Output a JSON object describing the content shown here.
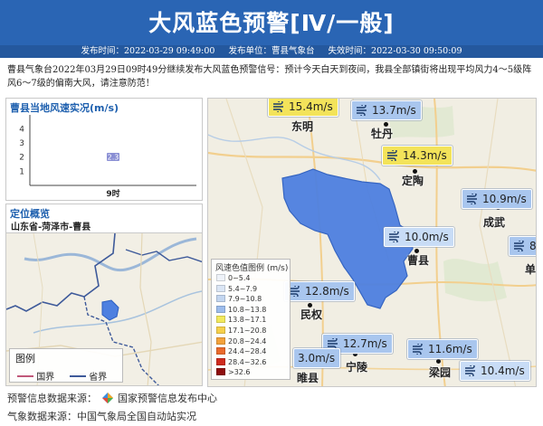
{
  "header": {
    "title": "大风蓝色预警[Ⅳ/一般]",
    "publish_time_label": "发布时间：2022-03-29 09:49:00",
    "publisher_label": "发布单位：曹县气象台",
    "expire_label": "失效时间：2022-03-30 09:50:09"
  },
  "description": "曹县气象台2022年03月29日09时49分继续发布大风蓝色预警信号：预计今天白天到夜间，我县全部镇街将出现平均风力4～5级阵风6～7级的偏南大风，请注意防范！",
  "wind_panel": {
    "title": "曹县当地风速实况(m/s)"
  },
  "chart_data": {
    "type": "bar",
    "title": "曹县当地风速实况(m/s)",
    "categories": [
      "9时"
    ],
    "values": [
      2.3
    ],
    "value_labels": [
      "2.3"
    ],
    "yticks": [
      "1",
      "2",
      "3",
      "4"
    ],
    "ylim": [
      0,
      4.6
    ],
    "grid": false,
    "bar_color": "#8a8fd4"
  },
  "location": {
    "title": "定位概览",
    "path": "山东省-菏泽市-曹县"
  },
  "minimap_legend": {
    "title": "图例",
    "items": [
      {
        "label": "国界",
        "color": "#c0587a"
      },
      {
        "label": "省界",
        "color": "#3e5a9a"
      }
    ]
  },
  "map": {
    "cities": [
      {
        "name": "东明"
      },
      {
        "name": "牡丹"
      },
      {
        "name": "定陶"
      },
      {
        "name": "成武"
      },
      {
        "name": "曹县"
      },
      {
        "name": "民权"
      },
      {
        "name": "宁陵"
      },
      {
        "name": "梁园"
      },
      {
        "name": "睢县"
      },
      {
        "name": "单"
      }
    ],
    "wind_labels": [
      {
        "text": "15.4m/s",
        "color": "yellow"
      },
      {
        "text": "13.7m/s",
        "color": "blue"
      },
      {
        "text": "14.3m/s",
        "color": "yellow"
      },
      {
        "text": "10.9m/s",
        "color": "blue"
      },
      {
        "text": "10.0m/s",
        "color": "lblue"
      },
      {
        "text": "8",
        "color": "blue"
      },
      {
        "text": "12.8m/s",
        "color": "blue"
      },
      {
        "text": "12.7m/s",
        "color": "blue"
      },
      {
        "text": "11.6m/s",
        "color": "blue"
      },
      {
        "text": "10.4m/s",
        "color": "lblue"
      },
      {
        "text": "3.0m/s",
        "color": "blue"
      }
    ]
  },
  "wind_legend": {
    "title": "风速色值图例 (m/s)",
    "items": [
      {
        "label": "0~5.4",
        "color": "#eef2f8"
      },
      {
        "label": "5.4~7.9",
        "color": "#dbe6f5"
      },
      {
        "label": "7.9~10.8",
        "color": "#c3d6f0"
      },
      {
        "label": "10.8~13.8",
        "color": "#9cbcec"
      },
      {
        "label": "13.8~17.1",
        "color": "#f2e95c"
      },
      {
        "label": "17.1~20.8",
        "color": "#f6d04a"
      },
      {
        "label": "20.8~24.4",
        "color": "#f3a23b"
      },
      {
        "label": "24.4~28.4",
        "color": "#ea6a2c"
      },
      {
        "label": "28.4~32.6",
        "color": "#cf2b1e"
      },
      {
        "label": ">32.6",
        "color": "#8e0e0e"
      }
    ]
  },
  "footer": {
    "warning_source": "预警信息数据来源：",
    "warning_source_name": "国家预警信息发布中心",
    "weather_source": "气象数据来源：中国气象局全国自动站实况"
  },
  "colors": {
    "banner": "#2a65b4",
    "warning_region": "#4e80e0",
    "accent_title": "#1d5fae"
  }
}
